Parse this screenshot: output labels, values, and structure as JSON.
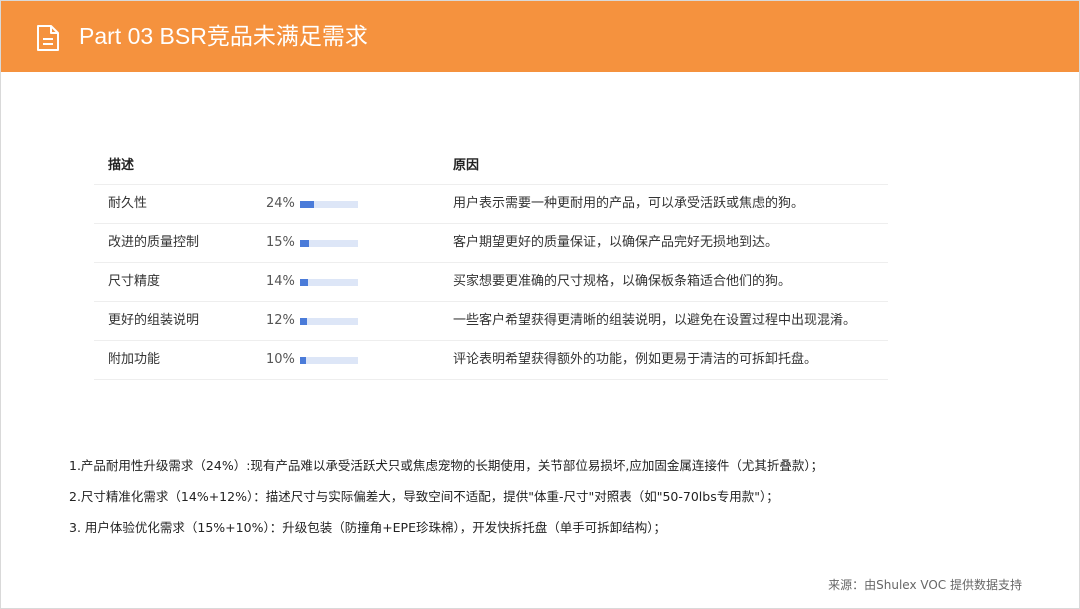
{
  "header": {
    "title": "Part 03  BSR竞品未满足需求",
    "icon": "document-icon",
    "bg_color": "#f5923e"
  },
  "table": {
    "col_desc": "描述",
    "col_reason": "原因",
    "rows": [
      {
        "desc": "耐久性",
        "pct": "24%",
        "level": 0.24,
        "reason": "用户表示需要一种更耐用的产品，可以承受活跃或焦虑的狗。"
      },
      {
        "desc": "改进的质量控制",
        "pct": "15%",
        "level": 0.15,
        "reason": "客户期望更好的质量保证，以确保产品完好无损地到达。"
      },
      {
        "desc": "尺寸精度",
        "pct": "14%",
        "level": 0.14,
        "reason": "买家想要更准确的尺寸规格，以确保板条箱适合他们的狗。"
      },
      {
        "desc": "更好的组装说明",
        "pct": "12%",
        "level": 0.12,
        "reason": "一些客户希望获得更清晰的组装说明，以避免在设置过程中出现混淆。"
      },
      {
        "desc": "附加功能",
        "pct": "10%",
        "level": 0.1,
        "reason": "评论表明希望获得额外的功能，例如更易于清洁的可拆卸托盘。"
      }
    ],
    "bar_color": "#4a7bd9",
    "bar_track_color": "#dde6f7"
  },
  "notes": [
    "1.产品耐用性升级需求（24%）:现有产品难以承受活跃犬只或焦虑宠物的长期使用，关节部位易损坏,应加固金属连接件（尤其折叠款）；",
    "2.尺寸精准化需求（14%+12%）：描述尺寸与实际偏差大，导致空间不适配，提供\"体重-尺寸\"对照表（如\"50-70lbs专用款\"）；",
    "3. 用户体验优化需求（15%+10%）：升级包装（防撞角+EPE珍珠棉），开发快拆托盘（单手可拆卸结构）；"
  ],
  "source": "来源：由Shulex VOC 提供数据支持"
}
